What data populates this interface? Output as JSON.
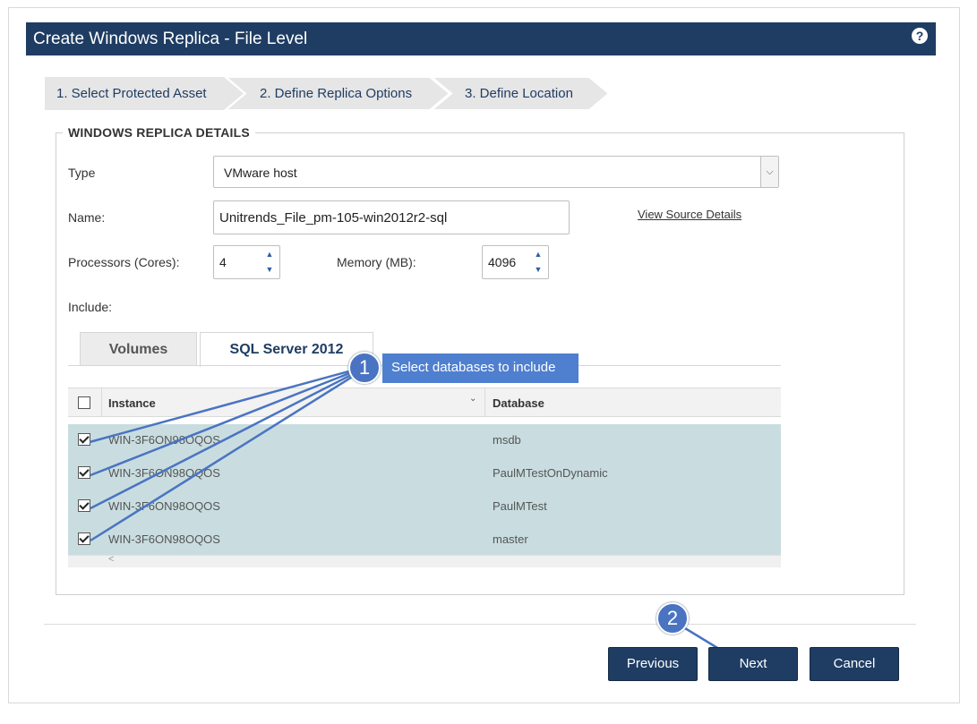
{
  "dialog": {
    "title": "Create Windows Replica - File Level",
    "help_icon": "question-icon"
  },
  "wizard": {
    "steps": [
      {
        "label": "1. Select Protected Asset"
      },
      {
        "label": "2. Define Replica Options"
      },
      {
        "label": "3. Define Location"
      }
    ]
  },
  "section": {
    "legend": "WINDOWS REPLICA DETAILS"
  },
  "form": {
    "type_label": "Type",
    "type_value": "VMware host",
    "name_label": "Name:",
    "name_value": "Unitrends_File_pm-105-win2012r2-sql",
    "view_source_link": "View Source Details",
    "processors_label": "Processors (Cores):",
    "processors_value": "4",
    "memory_label": "Memory (MB):",
    "memory_value": "4096",
    "include_label": "Include:"
  },
  "tabs": [
    {
      "label": "Volumes"
    },
    {
      "label": "SQL Server 2012"
    }
  ],
  "grid": {
    "columns": [
      "Instance",
      "Database"
    ],
    "rows": [
      {
        "instance": "WIN-3F6ON98OQOS",
        "database": "msdb",
        "checked": true
      },
      {
        "instance": "WIN-3F6ON98OQOS",
        "database": "PaulMTestOnDynamic",
        "checked": true
      },
      {
        "instance": "WIN-3F6ON98OQOS",
        "database": "PaulMTest",
        "checked": true
      },
      {
        "instance": "WIN-3F6ON98OQOS",
        "database": "master",
        "checked": true
      }
    ],
    "scroll_glyph": "<"
  },
  "annotations": {
    "badge1": "1",
    "callout1": "Select databases to include",
    "badge2": "2"
  },
  "buttons": {
    "previous": "Previous",
    "next": "Next",
    "cancel": "Cancel"
  },
  "colors": {
    "header": "#1f3d63",
    "row_selected": "#c9dde0",
    "annotation": "#4a74c2"
  }
}
